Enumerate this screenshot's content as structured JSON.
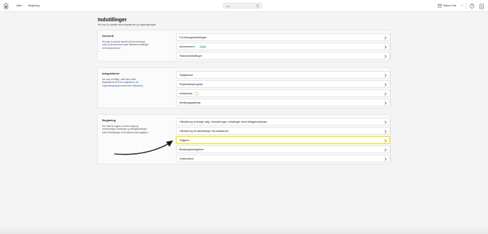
{
  "nav": {
    "home": "Hjem",
    "bookkeeping": "Bogføring",
    "search_placeholder": "Søg...",
    "user_name": "Marius Test"
  },
  "page": {
    "title": "Indstillinger",
    "subtitle": "Her kan du opsætte dine integrationer og bogføringsregler"
  },
  "sections": {
    "general": {
      "title": "Generelt",
      "desc_1": "Her kan du ændre navnet på din forretning,",
      "desc_2_link": "rette dit abonnement",
      "desc_2_rest": " samt håndtere betalinger",
      "desc_3": "af dit abonnement",
      "rows": [
        {
          "label": "Forretningsindstillinger"
        },
        {
          "label": "Abonnement",
          "badge": "Betalt"
        },
        {
          "label": "Fakturaindstillinger"
        }
      ]
    },
    "integrations": {
      "title": "Integrationer",
      "desc_1": "Her kan du tilføje, rette eller slette",
      "desc_2_pre": "integrationerne til din ",
      "desc_2_link": "salgskanal",
      "desc_2_post": ", dit",
      "desc_3_link": "regnskabsprogram",
      "desc_3_mid": " samt dine ",
      "desc_3_link2": "indløser(e)",
      "desc_3_post": ".",
      "rows": [
        {
          "label": "Salgskanal"
        },
        {
          "label": "Regnskabsprogram"
        },
        {
          "label": "Indløser(e)"
        },
        {
          "label": "Betalingsgateway"
        }
      ]
    },
    "bookkeeping": {
      "title": "Bogføring",
      "desc_1": "Her skal du angive, hvordan salg og",
      "desc_2": "refunderinger, betalinger og tilbagebetalinger",
      "desc_3": "samt indbetalinger fra indløsere skal bogføres.",
      "rows": [
        {
          "label": "Håndtering af øvrige salg, refunderinger, betalinger samt tilbagebetalinger"
        },
        {
          "label": "Håndtering af udbetalinger fra indløser(e)"
        },
        {
          "label": "Triggers"
        },
        {
          "label": "Betalingsbetingelser"
        },
        {
          "label": "Udsendelse"
        }
      ]
    }
  },
  "colors": {
    "highlight": "#f2e400",
    "link": "#2b62c9",
    "badge_bg": "#dcf5e3",
    "badge_text": "#1e8a44",
    "warning": "#f0a030"
  },
  "icons": {
    "logo": "app-logo-icon",
    "search": "search-icon",
    "user": "store-icon",
    "chevron": "chevron-down-icon",
    "help": "help-circle-icon",
    "doc": "document-icon",
    "row_arrow": "chevron-right-icon",
    "warning": "warning-icon",
    "annotation": "curved-arrow-annotation"
  }
}
